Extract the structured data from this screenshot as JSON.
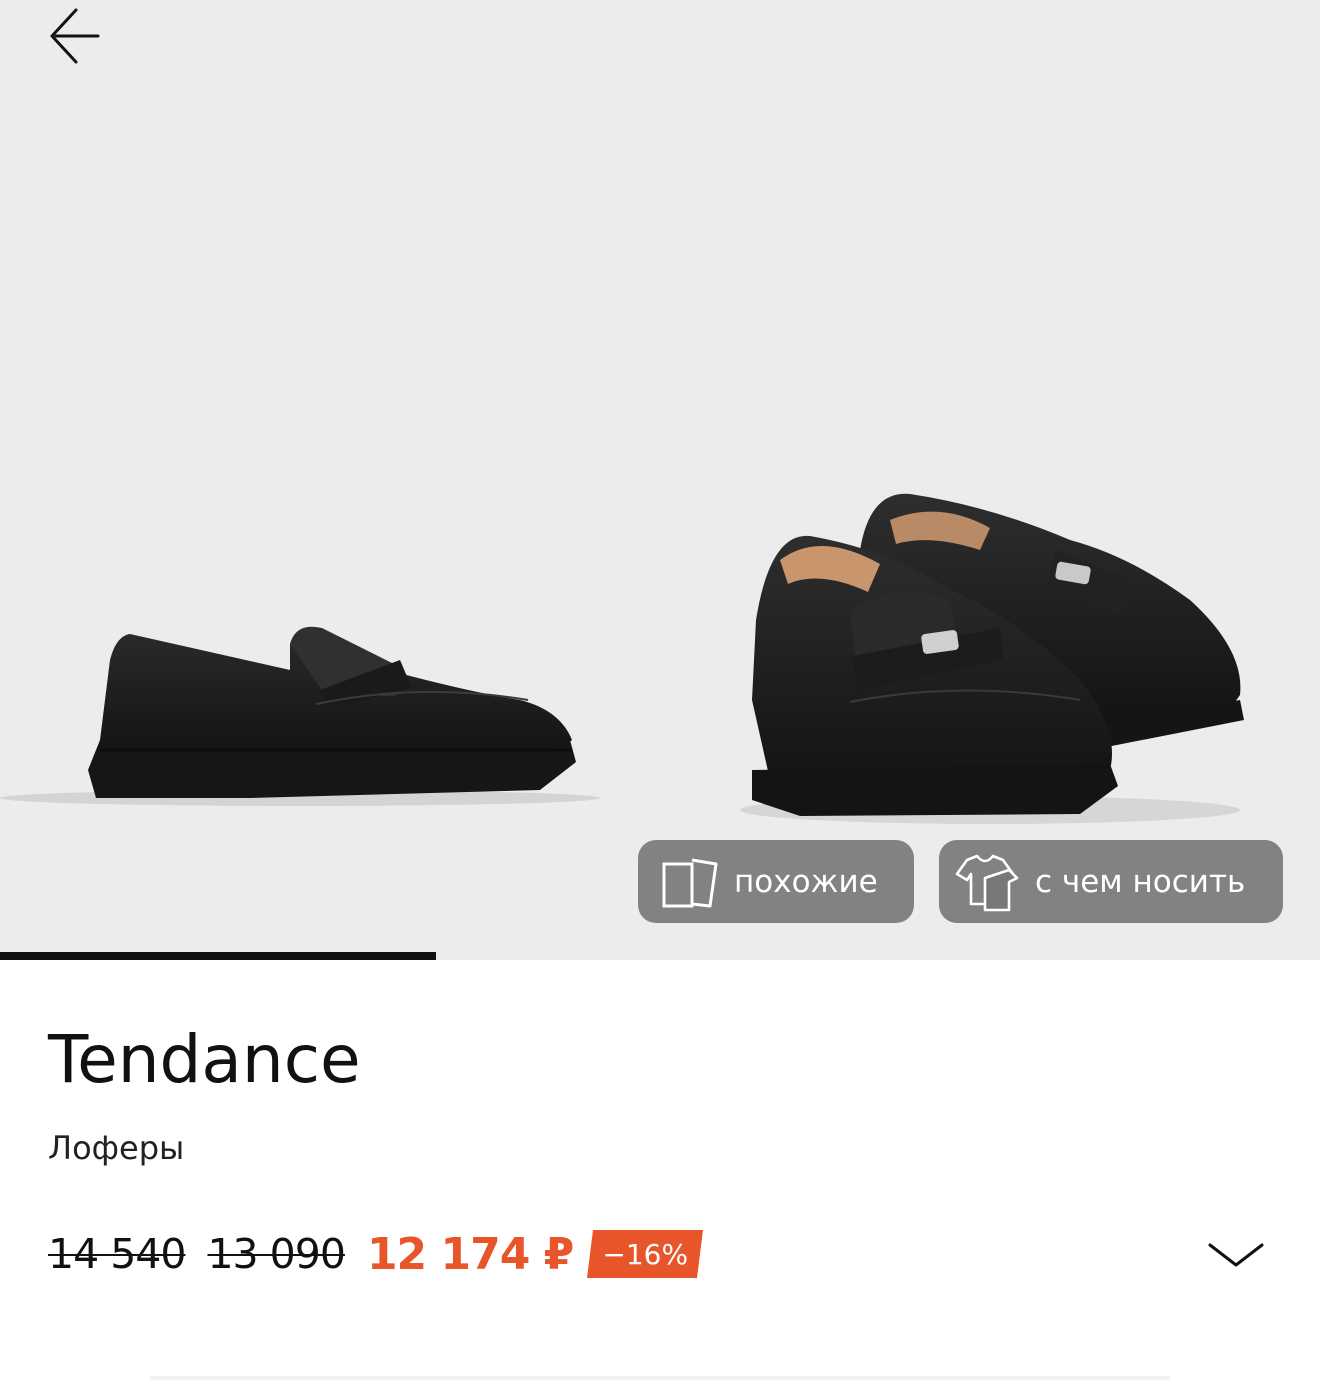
{
  "gallery": {
    "back_icon": "arrow-left-icon",
    "active_slide_progress": 0.33,
    "chips": {
      "similar_label": "похожие",
      "similar_icon": "cards-icon",
      "wear_with_label": "с чем носить",
      "wear_with_icon": "clothes-icon"
    }
  },
  "product": {
    "brand": "Tendance",
    "category": "Лоферы",
    "prices": {
      "original": "14 540",
      "previous": "13 090",
      "current": "12 174 ₽",
      "discount": "−16%"
    },
    "expand_icon": "chevron-down-icon"
  },
  "colors": {
    "accent": "#e8552a",
    "gallery_bg": "#ececee",
    "chip_bg": "#787878"
  }
}
